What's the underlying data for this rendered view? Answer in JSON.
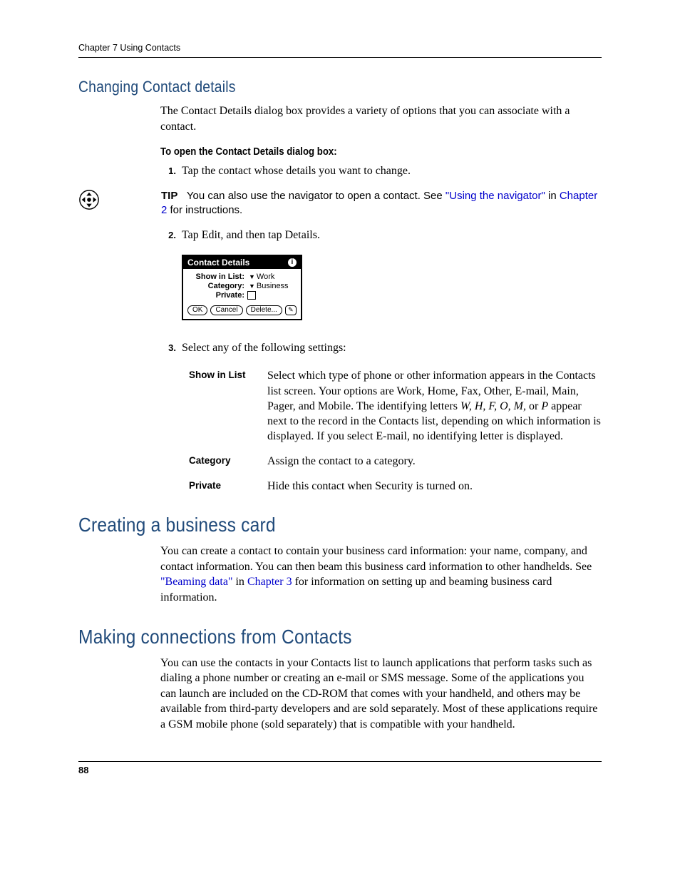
{
  "header": {
    "running": "Chapter 7    Using Contacts"
  },
  "section1": {
    "title": "Changing Contact details",
    "intro": "The Contact Details dialog box provides a variety of options that you can associate with a contact.",
    "procedure_title": "To open the Contact Details dialog box:",
    "step1_num": "1.",
    "step1_text": "Tap the contact whose details you want to change.",
    "tip_label": "TIP",
    "tip_text_a": "You can also use the navigator to open a contact. See ",
    "tip_link1": "\"Using the navigator\"",
    "tip_text_b": " in ",
    "tip_link2": "Chapter 2",
    "tip_text_c": " for instructions.",
    "step2_num": "2.",
    "step2_text": "Tap Edit, and then tap Details.",
    "step3_num": "3.",
    "step3_text": "Select any of the following settings:"
  },
  "dialog": {
    "title": "Contact Details",
    "info_glyph": "i",
    "row1_label": "Show in List:",
    "row1_value": "Work",
    "row2_label": "Category:",
    "row2_value": "Business",
    "row3_label": "Private:",
    "btn_ok": "OK",
    "btn_cancel": "Cancel",
    "btn_delete": "Delete...",
    "note_glyph": "✎"
  },
  "settings": {
    "row1_term": "Show in List",
    "row1_def_a": "Select which type of phone or other information appears in the Contacts list screen. Your options are Work, Home, Fax, Other, E-mail, Main, Pager, and Mobile. The identifying letters ",
    "row1_def_italic": "W, H, F, O, M,",
    "row1_def_b": " or ",
    "row1_def_italic2": "P",
    "row1_def_c": " appear next to the record in the Contacts list, depending on which information is displayed. If you select E-mail, no identifying letter is displayed.",
    "row2_term": "Category",
    "row2_def": "Assign the contact to a category.",
    "row3_term": "Private",
    "row3_def": "Hide this contact when Security is turned on."
  },
  "section2": {
    "title": "Creating a business card",
    "para_a": "You can create a contact to contain your business card information: your name, company, and contact information. You can then beam this business card information to other handhelds. See ",
    "link1": "\"Beaming data\"",
    "para_b": " in ",
    "link2": "Chapter 3",
    "para_c": " for information on setting up and beaming business card information."
  },
  "section3": {
    "title": "Making connections from Contacts",
    "para": "You can use the contacts in your Contacts list to launch applications that perform tasks such as dialing a phone number or creating an e-mail or SMS message. Some of the applications you can launch are included on the CD-ROM that comes with your handheld, and others may be available from third-party developers and are sold separately. Most of these applications require a GSM mobile phone (sold separately) that is compatible with your handheld."
  },
  "footer": {
    "page_number": "88"
  }
}
